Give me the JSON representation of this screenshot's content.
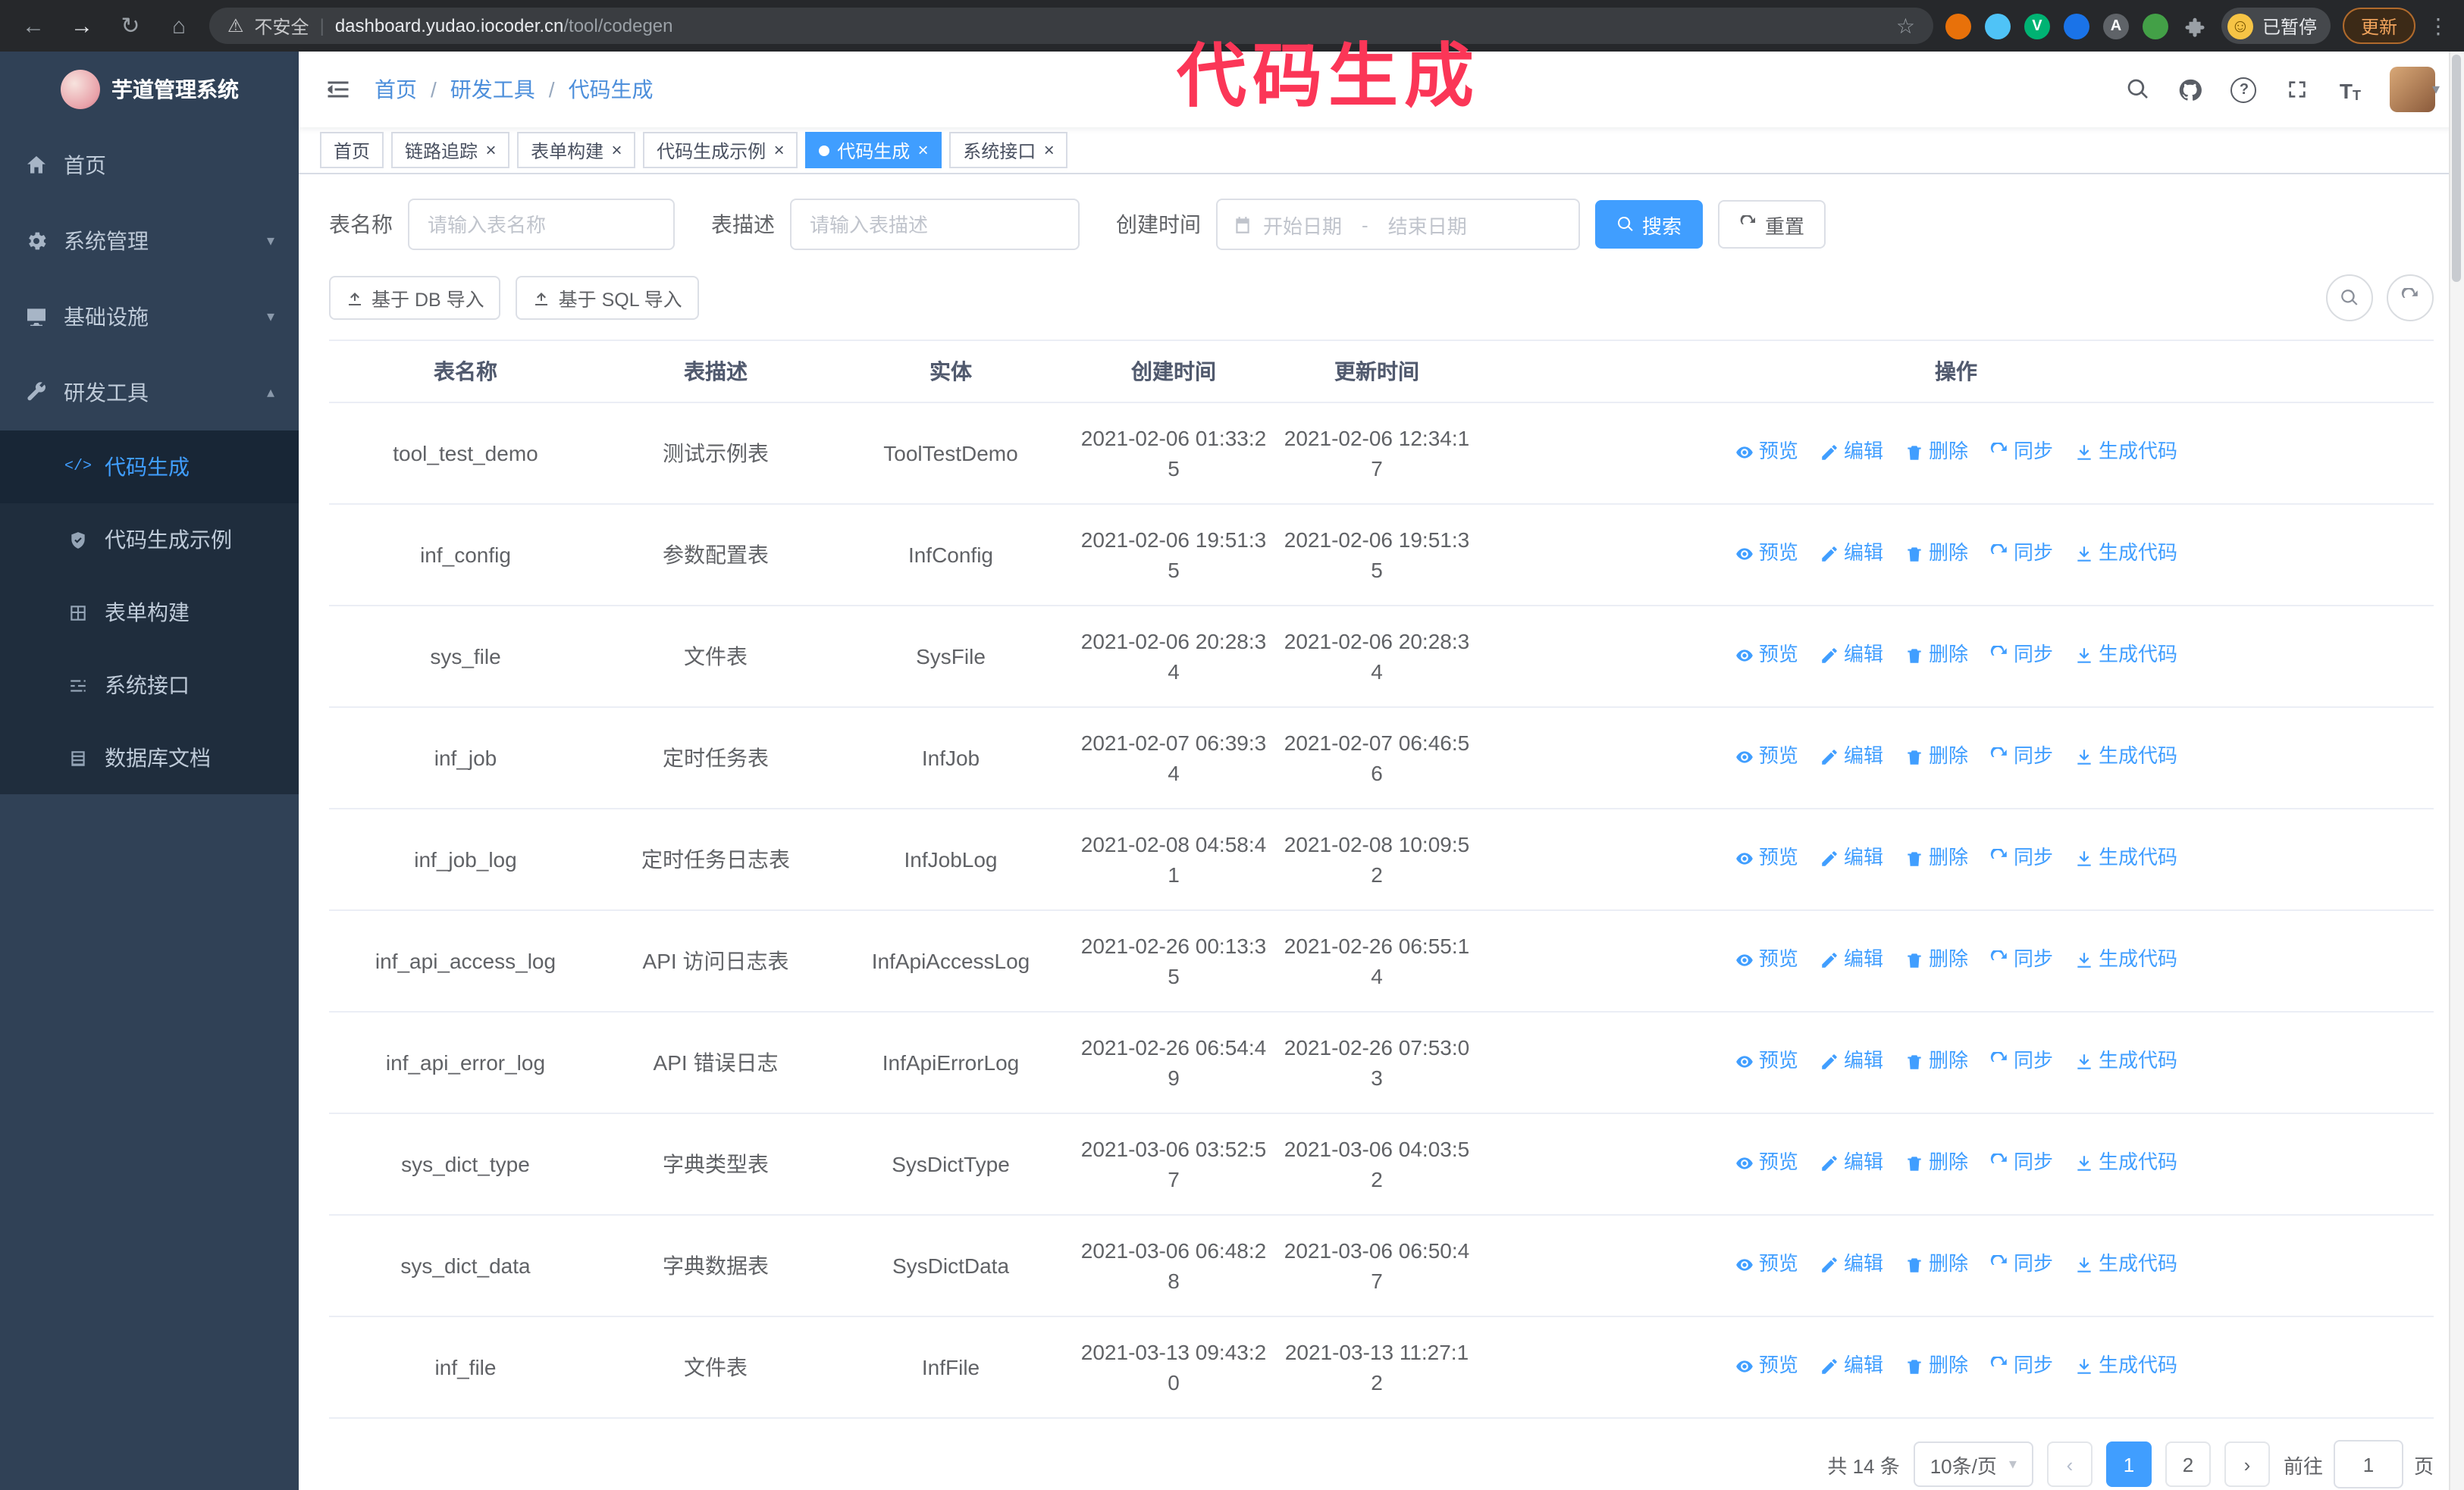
{
  "browser": {
    "security_label": "不安全",
    "url_host": "dashboard.yudao.iocoder.cn",
    "url_path": "/tool/codegen",
    "profile_badge": "已暂停",
    "update_button": "更新"
  },
  "annotation": {
    "text": "代码生成",
    "color": "#fb3657"
  },
  "sidebar": {
    "logo_title": "芋道管理系统",
    "items": [
      {
        "label": "首页",
        "icon": "home-icon"
      },
      {
        "label": "系统管理",
        "icon": "gear-icon",
        "chevron": "down"
      },
      {
        "label": "基础设施",
        "icon": "monitor-icon",
        "chevron": "down"
      },
      {
        "label": "研发工具",
        "icon": "wrench-icon",
        "chevron": "up"
      }
    ],
    "subitems": [
      {
        "label": "代码生成",
        "icon": "code-icon",
        "active": true
      },
      {
        "label": "代码生成示例",
        "icon": "shield-icon"
      },
      {
        "label": "表单构建",
        "icon": "form-icon"
      },
      {
        "label": "系统接口",
        "icon": "api-icon"
      },
      {
        "label": "数据库文档",
        "icon": "database-icon"
      }
    ]
  },
  "breadcrumb": [
    "首页",
    "研发工具",
    "代码生成"
  ],
  "tabs": [
    {
      "label": "首页",
      "closable": false,
      "active": false
    },
    {
      "label": "链路追踪",
      "closable": true,
      "active": false
    },
    {
      "label": "表单构建",
      "closable": true,
      "active": false
    },
    {
      "label": "代码生成示例",
      "closable": true,
      "active": false
    },
    {
      "label": "代码生成",
      "closable": true,
      "active": true
    },
    {
      "label": "系统接口",
      "closable": true,
      "active": false
    }
  ],
  "filters": {
    "name_label": "表名称",
    "name_placeholder": "请输入表名称",
    "desc_label": "表描述",
    "desc_placeholder": "请输入表描述",
    "time_label": "创建时间",
    "start_placeholder": "开始日期",
    "separator": "-",
    "end_placeholder": "结束日期",
    "search_label": "搜索",
    "reset_label": "重置"
  },
  "toolbar": {
    "import_db": "基于 DB 导入",
    "import_sql": "基于 SQL 导入"
  },
  "table": {
    "columns": [
      "表名称",
      "表描述",
      "实体",
      "创建时间",
      "更新时间",
      "操作"
    ],
    "actions": [
      "预览",
      "编辑",
      "删除",
      "同步",
      "生成代码"
    ],
    "rows": [
      {
        "name": "tool_test_demo",
        "desc": "测试示例表",
        "entity": "ToolTestDemo",
        "created": "2021-02-06 01:33:25",
        "updated": "2021-02-06 12:34:17"
      },
      {
        "name": "inf_config",
        "desc": "参数配置表",
        "entity": "InfConfig",
        "created": "2021-02-06 19:51:35",
        "updated": "2021-02-06 19:51:35"
      },
      {
        "name": "sys_file",
        "desc": "文件表",
        "entity": "SysFile",
        "created": "2021-02-06 20:28:34",
        "updated": "2021-02-06 20:28:34"
      },
      {
        "name": "inf_job",
        "desc": "定时任务表",
        "entity": "InfJob",
        "created": "2021-02-07 06:39:34",
        "updated": "2021-02-07 06:46:56"
      },
      {
        "name": "inf_job_log",
        "desc": "定时任务日志表",
        "entity": "InfJobLog",
        "created": "2021-02-08 04:58:41",
        "updated": "2021-02-08 10:09:52"
      },
      {
        "name": "inf_api_access_log",
        "desc": "API 访问日志表",
        "entity": "InfApiAccessLog",
        "created": "2021-02-26 00:13:35",
        "updated": "2021-02-26 06:55:14"
      },
      {
        "name": "inf_api_error_log",
        "desc": "API 错误日志",
        "entity": "InfApiErrorLog",
        "created": "2021-02-26 06:54:49",
        "updated": "2021-02-26 07:53:03"
      },
      {
        "name": "sys_dict_type",
        "desc": "字典类型表",
        "entity": "SysDictType",
        "created": "2021-03-06 03:52:57",
        "updated": "2021-03-06 04:03:52"
      },
      {
        "name": "sys_dict_data",
        "desc": "字典数据表",
        "entity": "SysDictData",
        "created": "2021-03-06 06:48:28",
        "updated": "2021-03-06 06:50:47"
      },
      {
        "name": "inf_file",
        "desc": "文件表",
        "entity": "InfFile",
        "created": "2021-03-13 09:43:20",
        "updated": "2021-03-13 11:27:12"
      }
    ]
  },
  "pagination": {
    "total": "共 14 条",
    "page_size": "10条/页",
    "pages": [
      {
        "label": "1",
        "active": true
      },
      {
        "label": "2",
        "active": false
      }
    ],
    "goto_label": "前往",
    "goto_value": "1",
    "goto_suffix": "页"
  },
  "colors": {
    "accent": "#409EFF",
    "sidebar_bg": "#304156",
    "submenu_bg": "#1f2d3d",
    "annotation": "#fb3657"
  },
  "icons": {
    "search-icon": "magnifier",
    "refresh-icon": "circular-arrow",
    "preview-icon": "eye",
    "edit-icon": "pencil",
    "delete-icon": "trash",
    "sync-icon": "circular-arrow",
    "generate-icon": "download-arrow",
    "import-icon": "upload-arrow",
    "calendar-icon": "calendar"
  }
}
